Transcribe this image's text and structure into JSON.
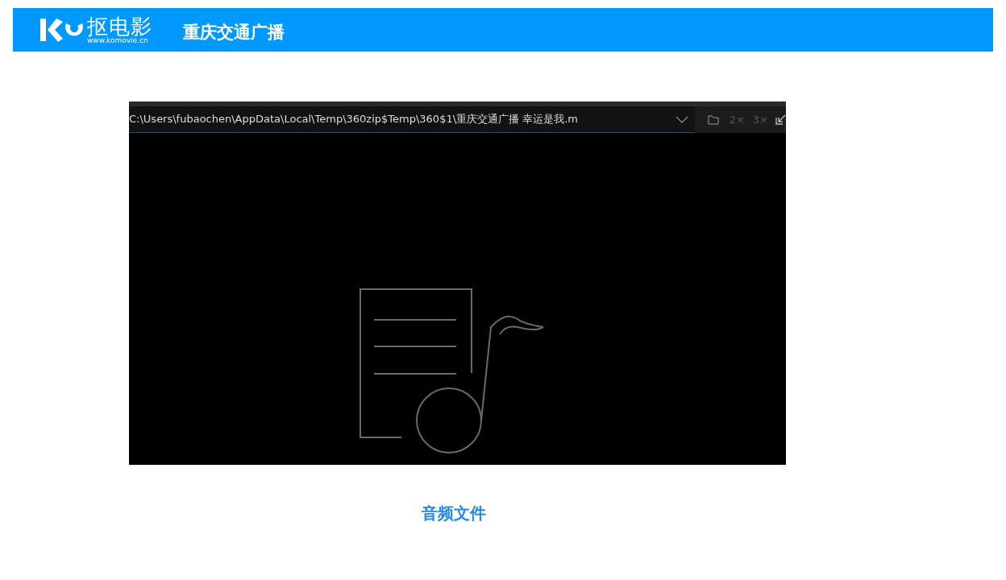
{
  "header": {
    "logo_name": "抠电影",
    "logo_url": "www.komovie.cn",
    "title": "重庆交通广播"
  },
  "player": {
    "path": "C:\\Users\\fubaochen\\AppData\\Local\\Temp\\360zip$Temp\\360$1\\重庆交通广播 幸运是我.m",
    "zoom_buttons": [
      {
        "label": "2×",
        "disabled": true
      },
      {
        "label": "3×",
        "disabled": true
      }
    ]
  },
  "caption": "音频文件"
}
